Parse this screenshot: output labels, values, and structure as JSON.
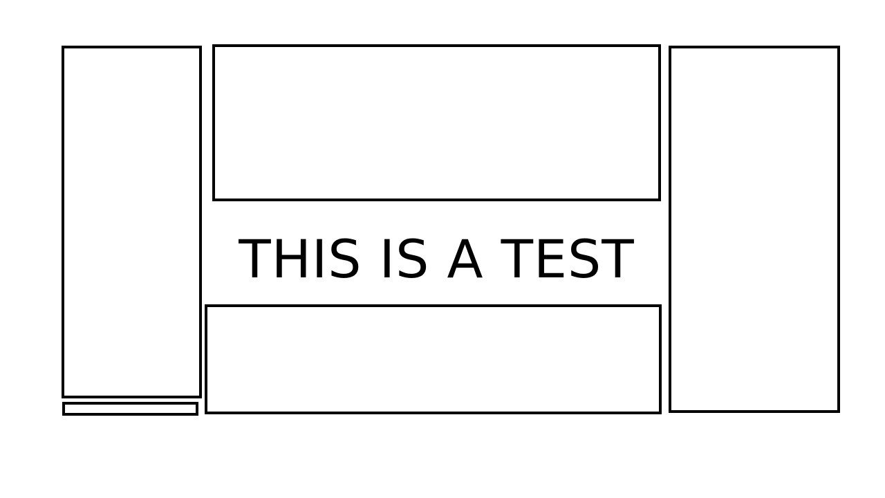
{
  "caption": "THIS IS A TEST",
  "colors": {
    "stroke": "#000000",
    "background": "#ffffff",
    "text": "#000000"
  }
}
